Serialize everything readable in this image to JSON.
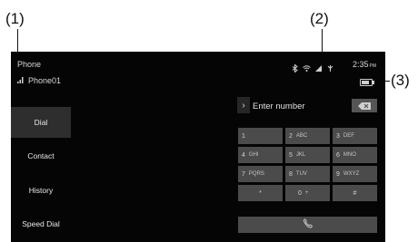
{
  "callouts": {
    "c1": "(1)",
    "c2": "(2)",
    "c3": "(3)"
  },
  "header": {
    "app_title": "Phone",
    "device_name": "Phone01",
    "time": "2:35",
    "time_suffix": "PM"
  },
  "status_icons": [
    "bluetooth-icon",
    "wifi-icon",
    "signal-icon",
    "antenna-icon"
  ],
  "nav": {
    "items": [
      {
        "label": "Dial",
        "active": true
      },
      {
        "label": "Contact",
        "active": false
      },
      {
        "label": "History",
        "active": false
      },
      {
        "label": "Speed Dial",
        "active": false
      }
    ]
  },
  "entry": {
    "placeholder": "Enter number"
  },
  "keypad": {
    "keys": [
      {
        "digit": "1",
        "letters": ""
      },
      {
        "digit": "2",
        "letters": "ABC"
      },
      {
        "digit": "3",
        "letters": "DEF"
      },
      {
        "digit": "4",
        "letters": "GHI"
      },
      {
        "digit": "5",
        "letters": "JKL"
      },
      {
        "digit": "6",
        "letters": "MNO"
      },
      {
        "digit": "7",
        "letters": "PQRS"
      },
      {
        "digit": "8",
        "letters": "TUV"
      },
      {
        "digit": "9",
        "letters": "WXYZ"
      },
      {
        "digit": "*",
        "letters": ""
      },
      {
        "digit": "0",
        "letters": "+"
      },
      {
        "digit": "#",
        "letters": ""
      }
    ]
  },
  "colors": {
    "screen_bg": "#050505",
    "key_bg": "#4b4b4b",
    "active_nav_bg": "#2e2e2e"
  }
}
